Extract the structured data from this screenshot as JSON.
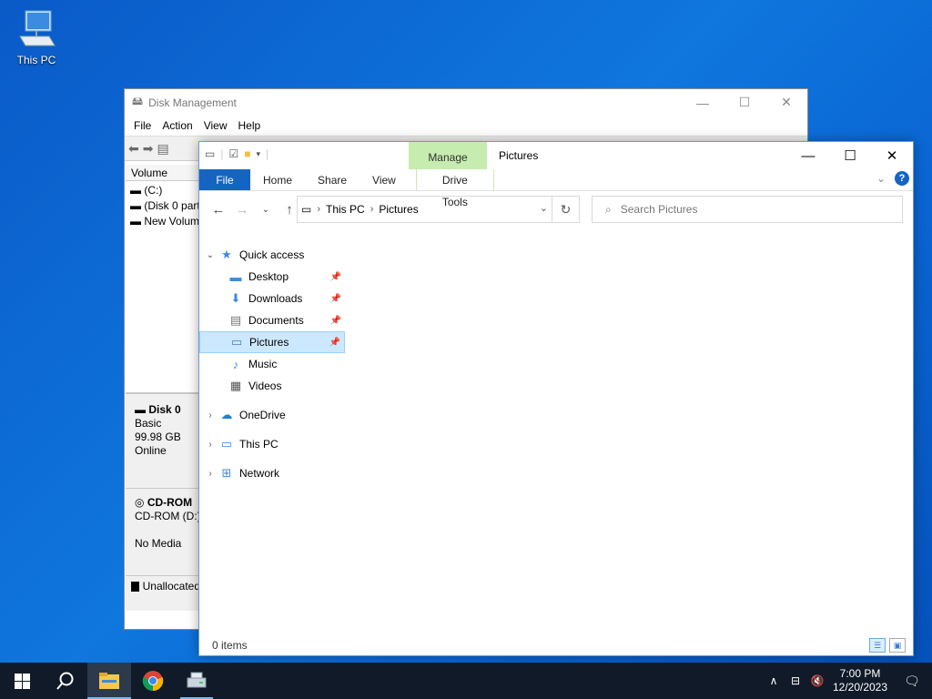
{
  "desktop": {
    "icons": [
      {
        "label": "This PC",
        "icon": "computer-icon"
      }
    ]
  },
  "disk_management": {
    "title": "Disk Management",
    "menu": [
      "File",
      "Action",
      "View",
      "Help"
    ],
    "volume_header": "Volume",
    "volumes": [
      "(C:)",
      "(Disk 0 part",
      "New Volum"
    ],
    "disk0": {
      "name": "Disk 0",
      "type": "Basic",
      "size": "99.98 GB",
      "status": "Online"
    },
    "cdrom": {
      "name": "CD-ROM",
      "drive": "CD-ROM (D:)",
      "media": "No Media"
    },
    "legend": "Unallocated"
  },
  "explorer": {
    "title": "Pictures",
    "context_tab": "Manage",
    "ribbon_tabs": [
      "File",
      "Home",
      "Share",
      "View"
    ],
    "context_subtab": "Drive Tools",
    "address": {
      "crumbs": [
        "This PC",
        "Pictures"
      ]
    },
    "search": {
      "placeholder": "Search Pictures"
    },
    "nav": {
      "quick_access": "Quick access",
      "quick_items": [
        {
          "label": "Desktop",
          "icon": "desktop-icon",
          "pinned": true
        },
        {
          "label": "Downloads",
          "icon": "downloads-icon",
          "pinned": true
        },
        {
          "label": "Documents",
          "icon": "documents-icon",
          "pinned": true
        },
        {
          "label": "Pictures",
          "icon": "pictures-icon",
          "pinned": true,
          "selected": true
        },
        {
          "label": "Music",
          "icon": "music-icon",
          "pinned": false
        },
        {
          "label": "Videos",
          "icon": "videos-icon",
          "pinned": false
        }
      ],
      "onedrive": "OneDrive",
      "thispc": "This PC",
      "network": "Network"
    },
    "status": "0 items"
  },
  "taskbar": {
    "time": "7:00 PM",
    "date": "12/20/2023",
    "colors": {
      "background": "#101a28",
      "accent": "#76b9ed"
    }
  }
}
